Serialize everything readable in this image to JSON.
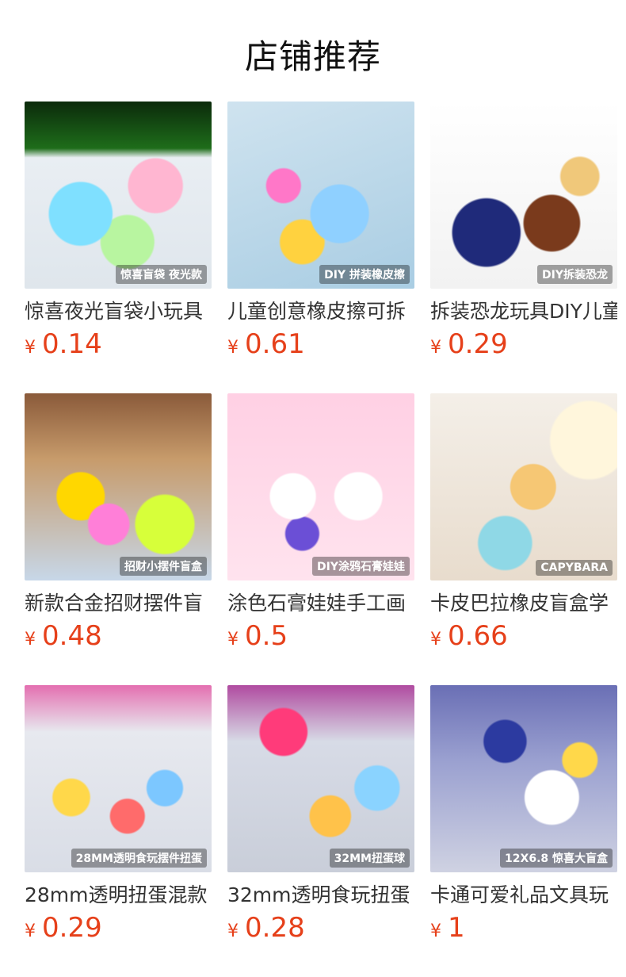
{
  "header": {
    "title": "店铺推荐"
  },
  "currency": "¥",
  "products": [
    {
      "title": "惊喜夜光盲袋小玩具",
      "price": "0.14",
      "thumb_text": "惊喜盲袋 夜光款"
    },
    {
      "title": "儿童创意橡皮擦可拆",
      "price": "0.61",
      "thumb_text": "DIY 拼装橡皮擦"
    },
    {
      "title": "拆装恐龙玩具DIY儿童",
      "price": "0.29",
      "thumb_text": "DIY拆装恐龙"
    },
    {
      "title": "新款合金招财摆件盲",
      "price": "0.48",
      "thumb_text": "招财小摆件盲盒"
    },
    {
      "title": "涂色石膏娃娃手工画",
      "price": "0.5",
      "thumb_text": "DIY涂鸦石膏娃娃"
    },
    {
      "title": "卡皮巴拉橡皮盲盒学",
      "price": "0.66",
      "thumb_text": "CAPYBARA"
    },
    {
      "title": "28mm透明扭蛋混款",
      "price": "0.29",
      "thumb_text": "28MM透明食玩摆件扭蛋"
    },
    {
      "title": "32mm透明食玩扭蛋",
      "price": "0.28",
      "thumb_text": "32MM扭蛋球"
    },
    {
      "title": "卡通可爱礼品文具玩",
      "price": "1",
      "thumb_text": "12X6.8 惊喜大盲盒"
    }
  ]
}
